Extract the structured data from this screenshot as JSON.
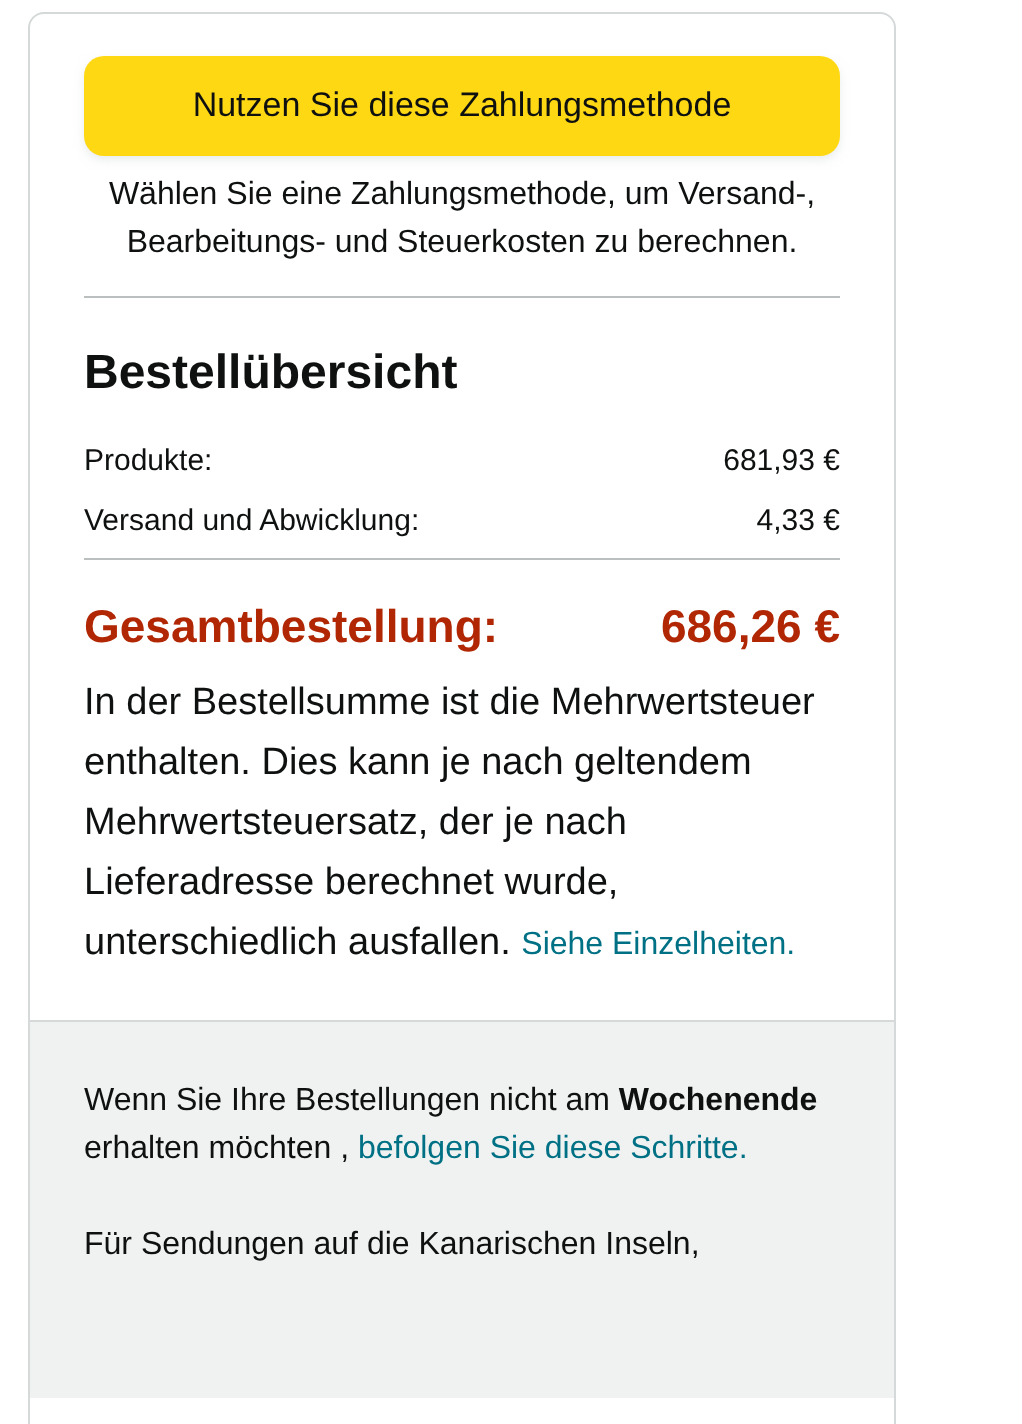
{
  "pay_button": {
    "label": "Nutzen Sie diese Zahlungsmethode"
  },
  "pay_note": "Wählen Sie eine Zahlungsmethode, um Versand-, Bearbeitungs- und Steuerkosten zu berechnen.",
  "summary": {
    "title": "Bestellübersicht",
    "rows": [
      {
        "label": "Produkte:",
        "value": "681,93 €"
      },
      {
        "label": "Versand und Abwicklung:",
        "value": "4,33 €"
      }
    ],
    "total": {
      "label": "Gesamtbestellung:",
      "value": "686,26 €"
    },
    "vat_note": {
      "text": "In der Bestellsumme ist die Mehrwertsteuer enthalten. Dies kann je nach geltendem Mehrwertsteuersatz, der je nach Lieferadresse berechnet wurde, unterschiedlich ausfallen.",
      "link": "Siehe Einzelheiten."
    }
  },
  "footer": {
    "weekend_note": {
      "text": "Wenn Sie Ihre Bestellungen nicht am **Wochenende** erhalten möchten ,",
      "link": "befolgen Sie diese Schritte."
    },
    "canary_note": "Für Sendungen auf die Kanarischen Inseln,"
  }
}
